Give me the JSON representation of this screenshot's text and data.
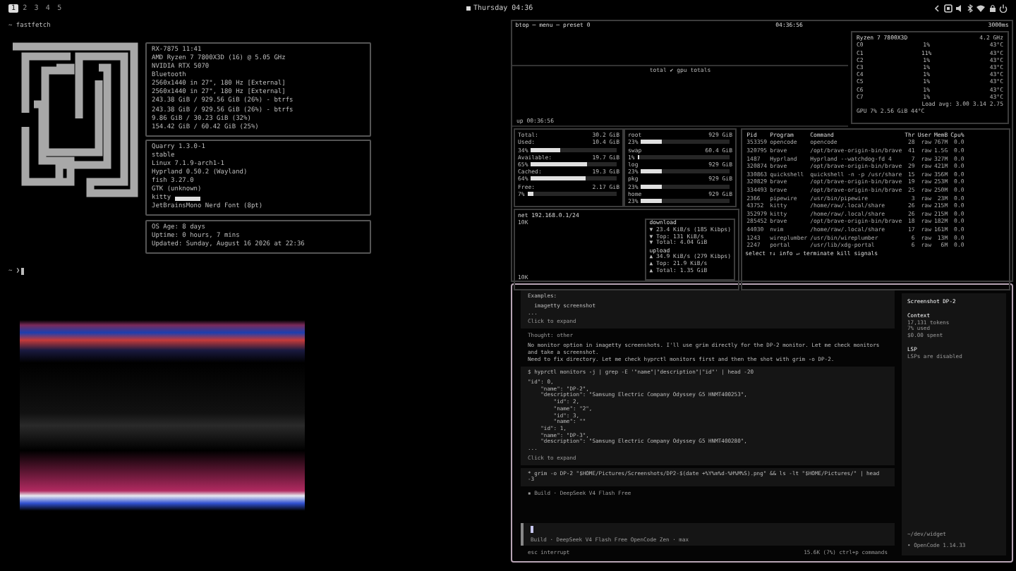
{
  "top_bar": {
    "workspaces": [
      {
        "label": "1",
        "selected": true
      },
      {
        "label": "2",
        "selected": false
      },
      {
        "label": "3",
        "selected": false
      },
      {
        "label": "4",
        "selected": false
      },
      {
        "label": "5",
        "selected": false
      }
    ],
    "clock": "Thursday 04:36"
  },
  "fastfetch": {
    "prompt": "~ fastfetch",
    "hardware": [
      "RX-7875 11:41",
      "AMD Ryzen 7 7800X3D (16) @ 5.05 GHz",
      "NVIDIA RTX 5070",
      "Bluetooth",
      "2560x1440 in 27\", 180 Hz [External]",
      "2560x1440 in 27\", 180 Hz [External]",
      "243.38 GiB / 929.56 GiB (26%) - btrfs",
      "243.38 GiB / 929.56 GiB (26%) - btrfs",
      "9.86 GiB / 30.23 GiB (32%)",
      "154.42 GiB / 60.42 GiB (25%)"
    ],
    "software": [
      "Quarry 1.3.0-1",
      "stable",
      "Linux 7.1.9-arch1-1",
      "Hyprland 0.50.2 (Wayland)",
      "fish 3.27.0",
      "GTK (unknown)",
      "kitty",
      "JetBrainsMono Nerd Font (8pt)"
    ],
    "uptime": [
      "OS Age: 8 days",
      "Uptime: 0 hours, 7 mins",
      "Updated: Sunday, August 16 2026 at 22:36"
    ],
    "prompt_end": "~ ❯"
  },
  "btop": {
    "title": "btop ─ menu ─ preset 0",
    "clock": "04:36:56",
    "refresh": "3000ms",
    "graph_label": "total ✔ gpu totals",
    "uptime": "up 00:36:56",
    "cpu": {
      "name": "Ryzen 7 7800X3D",
      "freq": "4.2 GHz",
      "cores": [
        {
          "label": "C0",
          "pct": "1%",
          "temp": "43°C"
        },
        {
          "label": "C1",
          "pct": "11%",
          "temp": "43°C"
        },
        {
          "label": "C2",
          "pct": "1%",
          "temp": "43°C"
        },
        {
          "label": "C3",
          "pct": "1%",
          "temp": "43°C"
        },
        {
          "label": "C4",
          "pct": "1%",
          "temp": "43°C"
        },
        {
          "label": "C5",
          "pct": "1%",
          "temp": "43°C"
        },
        {
          "label": "C6",
          "pct": "1%",
          "temp": "43°C"
        },
        {
          "label": "C7",
          "pct": "1%",
          "temp": "43°C"
        }
      ],
      "load": "Load avg: 3.00 3.14 2.75",
      "gpu": "GPU  7%  2.56 GiB  44°C"
    },
    "mem": [
      {
        "label": "Total:",
        "value": "30.2 GiB"
      },
      {
        "label": "Used:",
        "value": "10.4 GiB",
        "pct": "34%",
        "level": 0.34
      },
      {
        "label": "Available:",
        "value": "19.7 GiB",
        "pct": "65%",
        "level": 0.65
      },
      {
        "label": "Cached:",
        "value": "19.3 GiB",
        "pct": "64%",
        "level": 0.64
      },
      {
        "label": "Free:",
        "value": "2.17 GiB",
        "pct": "7%",
        "level": 0.07
      }
    ],
    "disks": [
      {
        "label": "root",
        "value": "929 GiB",
        "pct": "23%",
        "level": 0.23
      },
      {
        "label": "swap",
        "value": "60.4 GiB",
        "pct": "1%",
        "level": 0.01
      },
      {
        "label": "log",
        "value": "929 GiB",
        "pct": "23%",
        "level": 0.23
      },
      {
        "label": "pkg",
        "value": "929 GiB",
        "pct": "23%",
        "level": 0.23
      },
      {
        "label": "home",
        "value": "929 GiB",
        "pct": "23%",
        "level": 0.23
      }
    ],
    "net": {
      "title": "net  192.168.0.1/24",
      "scale_top": "10K",
      "scale_bottom": "10K",
      "download_label": "download",
      "download": [
        "▼ 23.4 KiB/s (185 Kibps)",
        "▼ Top: 131 KiB/s",
        "▼ Total: 4.04 GiB"
      ],
      "upload_label": "upload",
      "upload": [
        "▲ 34.9 KiB/s (279 Kibps)",
        "▲ Top: 21.9 KiB/s",
        "▲ Total: 1.35 GiB"
      ]
    },
    "proc": {
      "columns": [
        "Pid",
        "Program",
        "Command",
        "Thr",
        "User",
        "MemB",
        "Cpu%"
      ],
      "rows": [
        [
          "353359",
          "opencode",
          "opencode",
          "28",
          "raw",
          "767M",
          "0.0"
        ],
        [
          "320795",
          "brave",
          "/opt/brave-origin-bin/brave",
          "41",
          "raw",
          "1.5G",
          "0.0"
        ],
        [
          "1487",
          "Hyprland",
          "Hyprland --watchdog-fd 4",
          "7",
          "raw",
          "327M",
          "0.0"
        ],
        [
          "320874",
          "brave",
          "/opt/brave-origin-bin/brave",
          "29",
          "raw",
          "421M",
          "0.0"
        ],
        [
          "330863",
          "quickshell",
          "quickshell -n -p /usr/share",
          "15",
          "raw",
          "356M",
          "0.0"
        ],
        [
          "320829",
          "brave",
          "/opt/brave-origin-bin/brave",
          "19",
          "raw",
          "253M",
          "0.0"
        ],
        [
          "334493",
          "brave",
          "/opt/brave-origin-bin/brave",
          "25",
          "raw",
          "250M",
          "0.0"
        ],
        [
          "2366",
          "pipewire",
          "/usr/bin/pipewire",
          "3",
          "raw",
          "23M",
          "0.0"
        ],
        [
          "43752",
          "kitty",
          "/home/raw/.local/share",
          "26",
          "raw",
          "215M",
          "0.0"
        ],
        [
          "352979",
          "kitty",
          "/home/raw/.local/share",
          "26",
          "raw",
          "215M",
          "0.0"
        ],
        [
          "285452",
          "brave",
          "/opt/brave-origin-bin/brave",
          "18",
          "raw",
          "182M",
          "0.0"
        ],
        [
          "44030",
          "nvim",
          "/home/raw/.local/share",
          "17",
          "raw",
          "161M",
          "0.0"
        ],
        [
          "1243",
          "wireplumber",
          "/usr/bin/wireplumber",
          "6",
          "raw",
          "13M",
          "0.0"
        ],
        [
          "2247",
          "portal",
          "/usr/lib/xdg-portal",
          "6",
          "raw",
          "6M",
          "0.0"
        ]
      ],
      "footer": "select ↑↓  info ↵  terminate  kill  signals"
    }
  },
  "opencode": {
    "blocks": [
      {
        "kind": "output",
        "lines": [
          "Examples:",
          "  imagetty screenshot",
          "..."
        ],
        "action": "Click to expand"
      },
      {
        "kind": "thought",
        "lines": [
          "Thought: other"
        ]
      },
      {
        "kind": "text",
        "lines": [
          "No monitor option in imagetty screenshots. I'll use grim directly for the DP-2 monitor. Let me check monitors and take a screenshot.",
          "Need to fix directory. Let me check hyprctl monitors first and then the shot with grim -o DP-2."
        ]
      },
      {
        "kind": "output",
        "lines": [
          "$ hyprctl monitors -j | grep -E '\"name\"|\"description\"|\"id\"' | head -20",
          "\"id\": 0,",
          "    \"name\": \"DP-2\",",
          "    \"description\": \"Samsung Electric Company Odyssey G5 HNMT400253\",",
          "        \"id\": 2,",
          "        \"name\": \"2\",",
          "        \"id\": 3,",
          "        \"name\": \"\"",
          "    \"id\": 1,",
          "    \"name\": \"DP-3\",",
          "    \"description\": \"Samsung Electric Company Odyssey G5 HNMT400280\",",
          "..."
        ],
        "action": "Click to expand"
      },
      {
        "kind": "command",
        "lines": [
          "* grim -o DP-2 \"$HOME/Pictures/Screenshots/DP2-$(date +%Y%m%d-%H%M%S).png\" && ls -lt \"$HOME/Pictures/\" | head -3"
        ]
      },
      {
        "kind": "status",
        "lines": [
          "▪ Build · DeepSeek V4 Flash Free"
        ]
      }
    ],
    "input_meta": "Build · DeepSeek V4 Flash Free OpenCode Zen · max",
    "footer_left": "esc interrupt",
    "footer_right": "15.6K (7%)  ctrl+p commands",
    "sidebar": {
      "title": "Screenshot DP-2",
      "sections": [
        {
          "heading": "Context",
          "lines": [
            "17,131 tokens",
            "7% used",
            "$0.00 spent"
          ]
        },
        {
          "heading": "LSP",
          "lines": [
            "LSPs are disabled"
          ]
        }
      ],
      "path": "~/dev/widget",
      "version": "• OpenCode 1.14.33"
    }
  }
}
